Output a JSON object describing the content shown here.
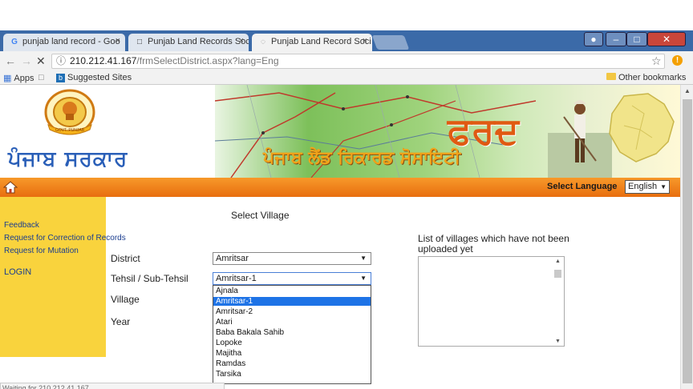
{
  "browser": {
    "tabs": [
      {
        "label": "punjab land record - Goo",
        "icon": "google-icon",
        "active": false
      },
      {
        "label": "Punjab Land Records Soc",
        "icon": "page-icon",
        "active": false
      },
      {
        "label": "Punjab Land Record Soci",
        "icon": "loading-icon",
        "active": true
      }
    ],
    "tab_close": "×",
    "address": {
      "host": "210.212.41.167",
      "path": "/frmSelectDistrict.aspx?lang=Eng"
    },
    "bookmarks": {
      "apps": "Apps",
      "suggested": "Suggested Sites",
      "other": "Other bookmarks"
    },
    "status": "Waiting for 210.212.41.167..."
  },
  "site": {
    "brand": "ਪੰਜਾਬ ਸਰਕਾਰ",
    "emblem_text": "GOVT. PUNJAB",
    "banner_title": "ਫਰਦ",
    "banner_subtitle": "ਪੰਜਾਬ ਲੈਂਡ ਰਿਕਾਰਡ ਸੋਸਾਇਟੀ",
    "colors": {
      "orange": "#e86e0f",
      "yellow": "#f9d33d",
      "brand_blue": "#2a5fb8",
      "selection": "#1e73e6"
    }
  },
  "nav": {
    "select_language_label": "Select Language",
    "language_value": "English"
  },
  "sidebar": {
    "items": [
      {
        "label": "Feedback"
      },
      {
        "label": "Request for Correction of Records"
      },
      {
        "label": "Request for Mutation"
      }
    ],
    "login": "LOGIN"
  },
  "form": {
    "heading": "Select Village",
    "district_label": "District",
    "district_value": "Amritsar",
    "tehsil_label": "Tehsil / Sub-Tehsil",
    "tehsil_value": "Amritsar-1",
    "village_label": "Village",
    "year_label": "Year",
    "tehsil_options": [
      "Ajnala",
      "Amritsar-1",
      "Amritsar-2",
      "Atari",
      "Baba Bakala Sahib",
      "Lopoke",
      "Majitha",
      "Ramdas",
      "Tarsika"
    ],
    "selected_option": "Amritsar-1"
  },
  "villages_panel": {
    "title": "List of villages which have not been uploaded yet"
  }
}
